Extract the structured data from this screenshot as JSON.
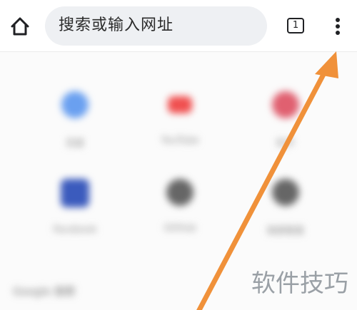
{
  "toolbar": {
    "home_icon": "home-icon",
    "search_placeholder": "搜索或输入网址",
    "tab_count": "1",
    "menu_icon": "more-vert-icon"
  },
  "shortcuts": [
    {
      "label": "百度",
      "icon_color": "#6aa0f0"
    },
    {
      "label": "YouTube",
      "icon_color": "#f05050"
    },
    {
      "label": "知乎",
      "icon_color": "#e06070"
    },
    {
      "label": "Facebook",
      "icon_color": "#3b5bbd"
    },
    {
      "label": "GitHub",
      "icon_color": "#666666"
    },
    {
      "label": "随便看看",
      "icon_color": "#666666"
    }
  ],
  "section_label": "Google 搜索",
  "watermark": "软件技巧",
  "colors": {
    "annotation_arrow": "#f0913a"
  }
}
